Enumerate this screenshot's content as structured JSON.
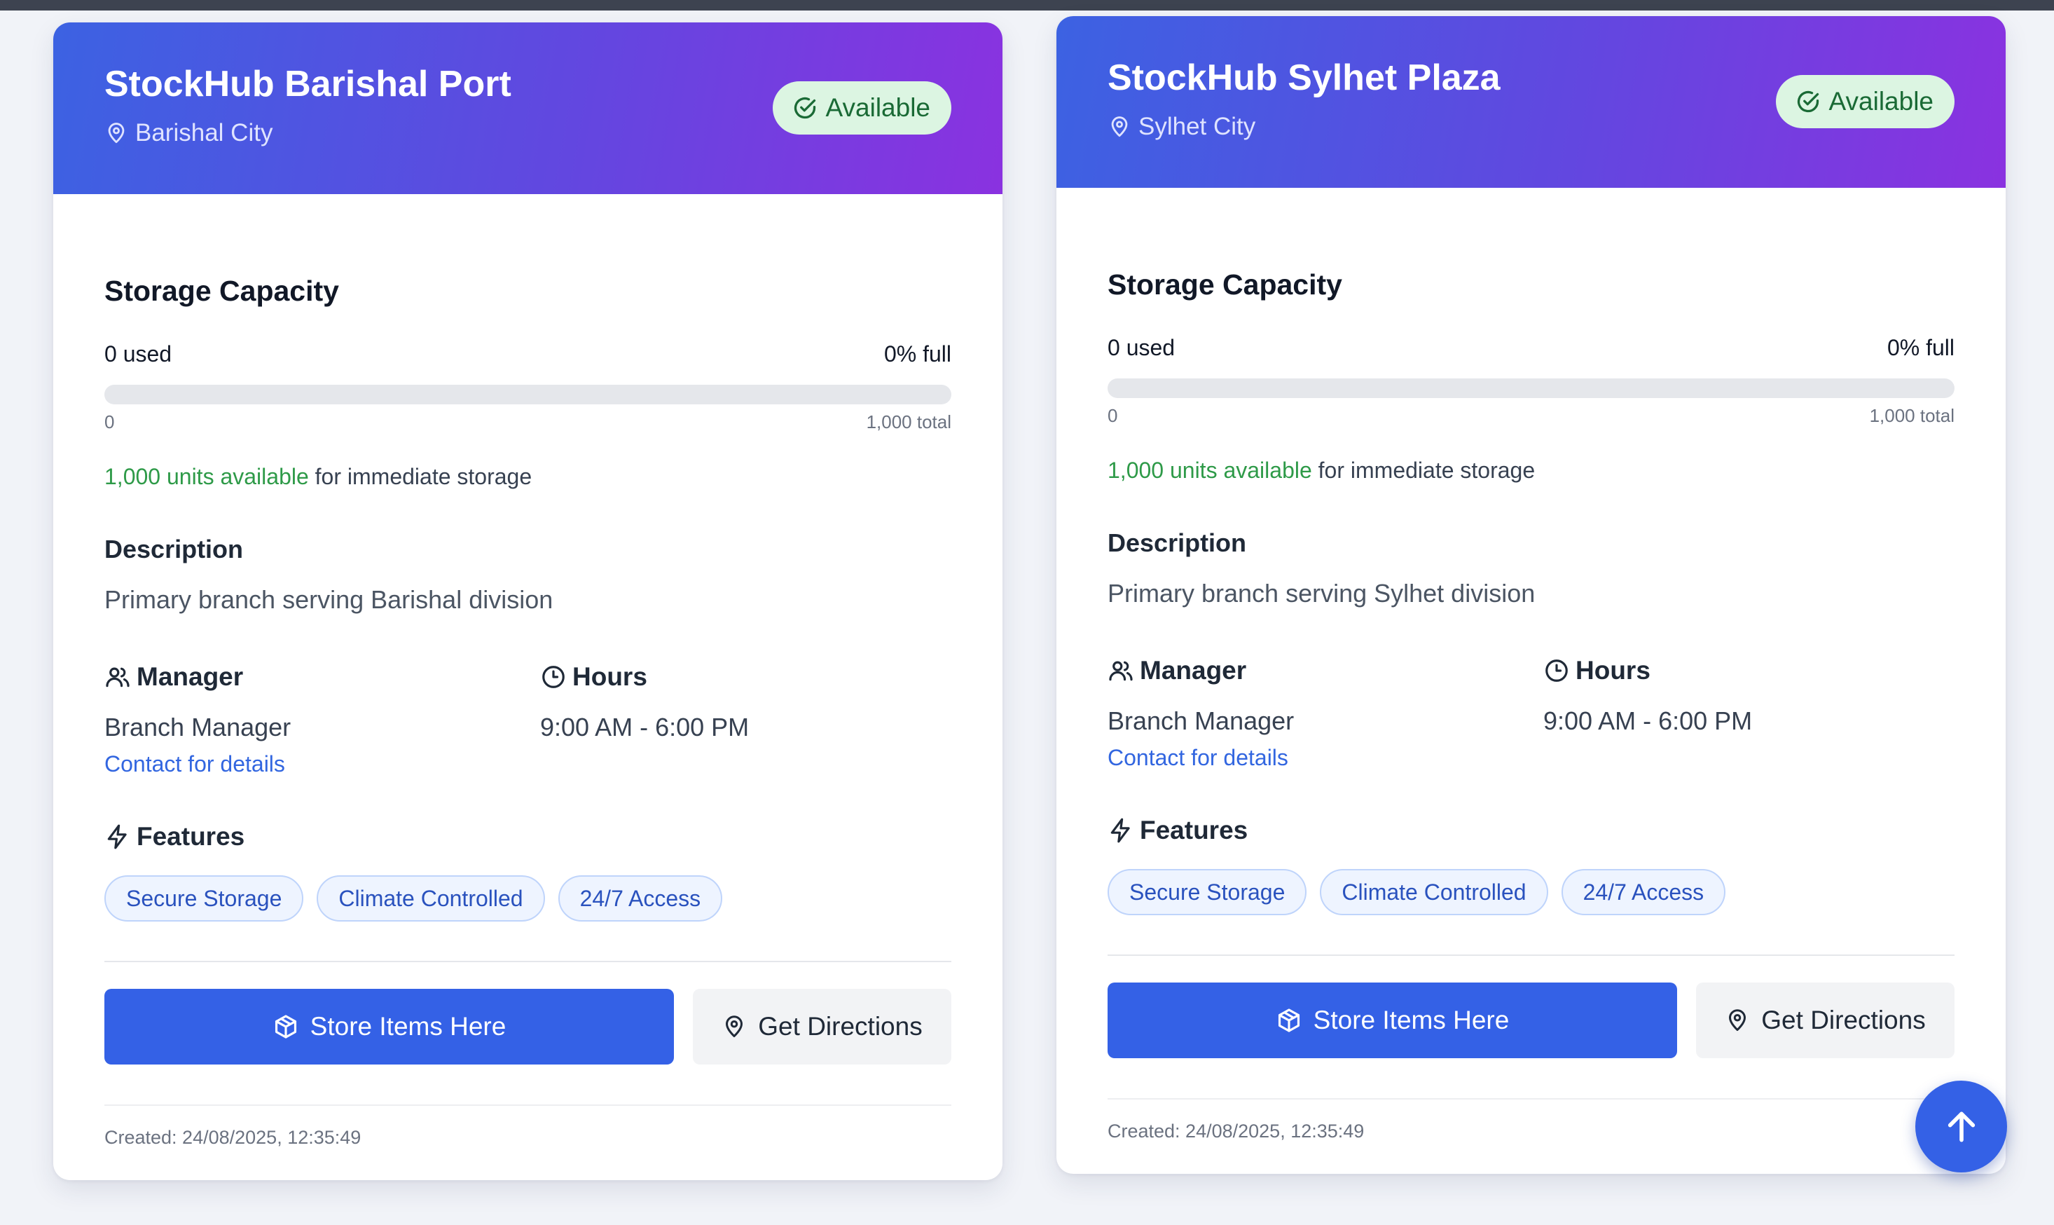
{
  "colors": {
    "header_gradient": [
      "#3c62e2",
      "#8a32e0"
    ],
    "primary_button": "#3461e6",
    "available_badge_bg": "#dcf5e2",
    "available_green": "#2e9a48",
    "link_blue": "#3266e0"
  },
  "cards": [
    {
      "title": "StockHub Barishal Port",
      "city": "Barishal City",
      "status": "Available",
      "storage": {
        "heading": "Storage Capacity",
        "used": "0 used",
        "percent": "0% full",
        "fill_fraction": 0,
        "min": "0",
        "total": "1,000 total",
        "available_highlight": "1,000 units available",
        "available_rest": " for immediate storage"
      },
      "description_heading": "Description",
      "description": "Primary branch serving Barishal division",
      "manager_heading": "Manager",
      "manager": "Branch Manager",
      "contact_link": "Contact for details",
      "hours_heading": "Hours",
      "hours": "9:00 AM - 6:00 PM",
      "features_heading": "Features",
      "features": [
        "Secure Storage",
        "Climate Controlled",
        "24/7 Access"
      ],
      "store_button": "Store Items Here",
      "directions_button": "Get Directions",
      "created": "Created: 24/08/2025, 12:35:49"
    },
    {
      "title": "StockHub Sylhet Plaza",
      "city": "Sylhet City",
      "status": "Available",
      "storage": {
        "heading": "Storage Capacity",
        "used": "0 used",
        "percent": "0% full",
        "fill_fraction": 0,
        "min": "0",
        "total": "1,000 total",
        "available_highlight": "1,000 units available",
        "available_rest": " for immediate storage"
      },
      "description_heading": "Description",
      "description": "Primary branch serving Sylhet division",
      "manager_heading": "Manager",
      "manager": "Branch Manager",
      "contact_link": "Contact for details",
      "hours_heading": "Hours",
      "hours": "9:00 AM - 6:00 PM",
      "features_heading": "Features",
      "features": [
        "Secure Storage",
        "Climate Controlled",
        "24/7 Access"
      ],
      "store_button": "Store Items Here",
      "directions_button": "Get Directions",
      "created": "Created: 24/08/2025, 12:35:49"
    }
  ],
  "scroll_top_icon": "arrow-up-icon"
}
